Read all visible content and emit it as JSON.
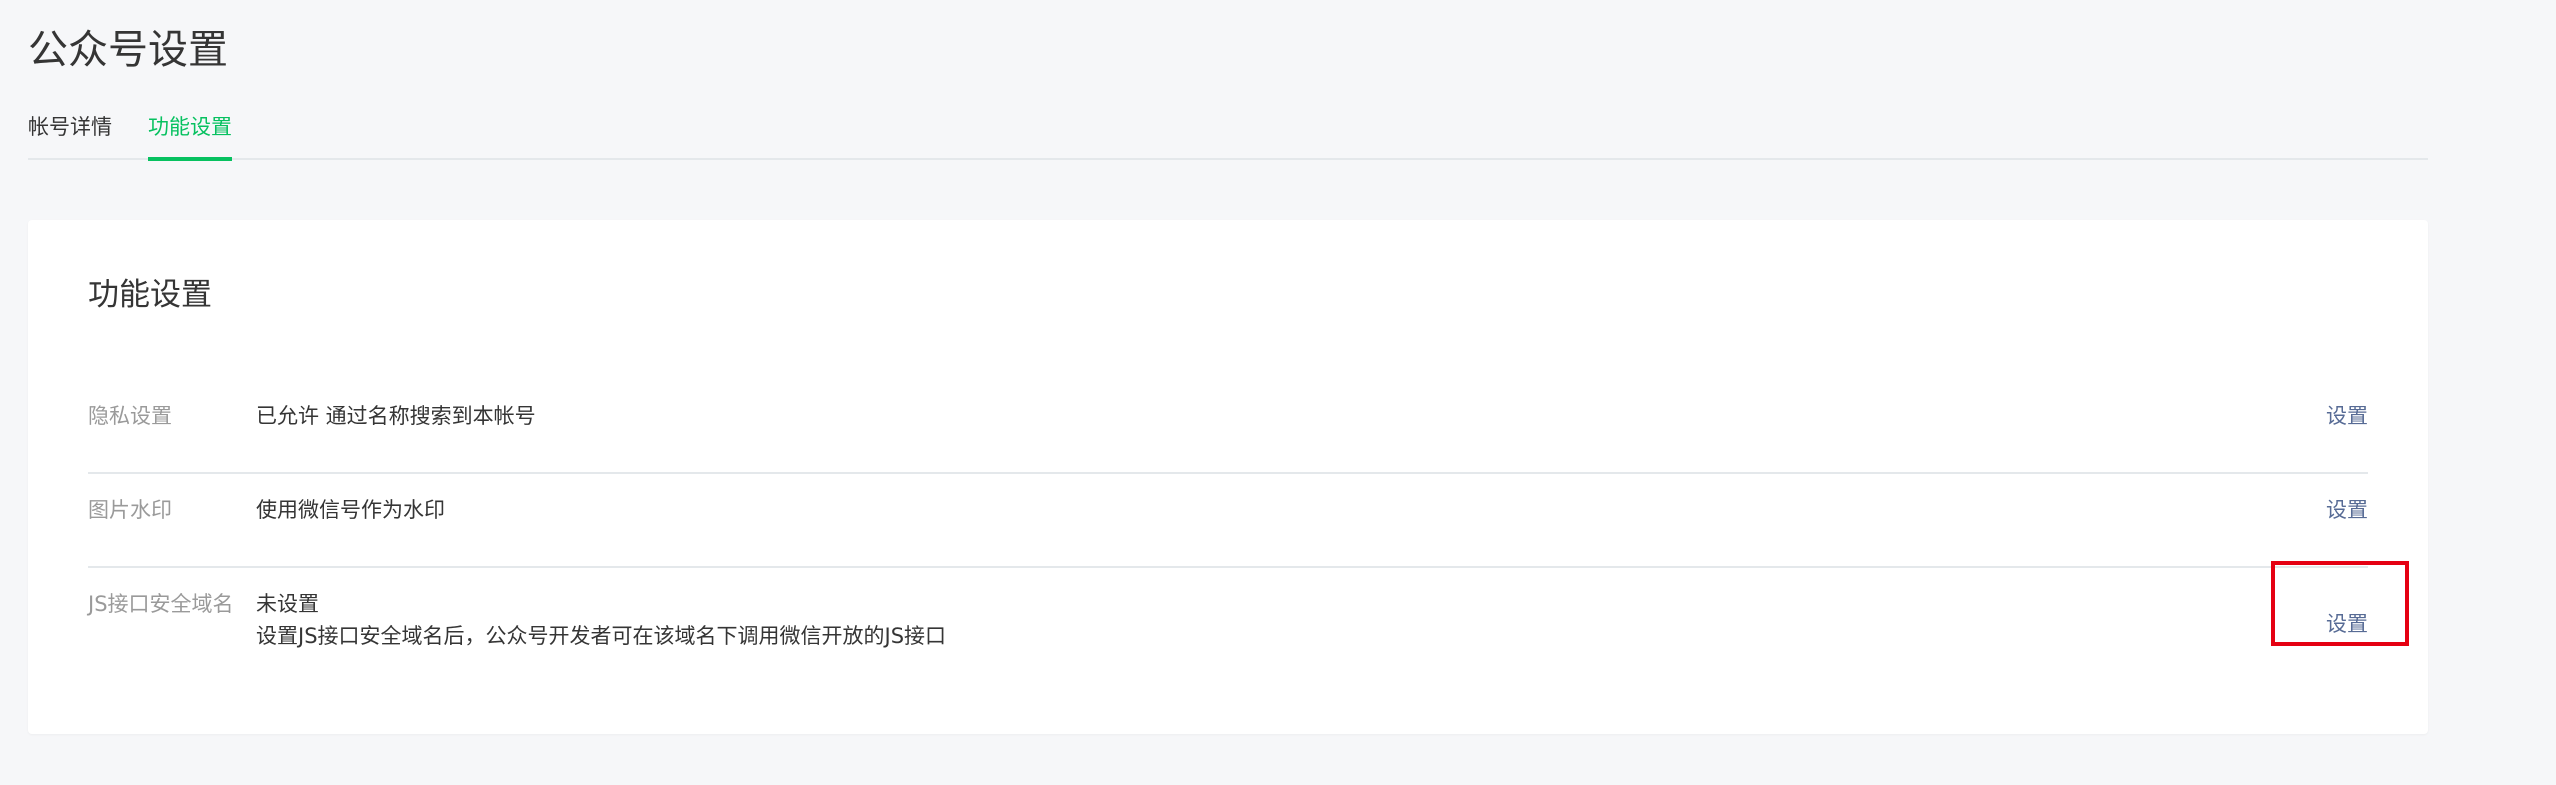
{
  "page": {
    "title": "公众号设置"
  },
  "tabs": [
    {
      "label": "帐号详情",
      "active": false
    },
    {
      "label": "功能设置",
      "active": true
    }
  ],
  "colors": {
    "accent": "#07c160",
    "link": "#576b95",
    "highlight": "#e50012",
    "background": "#f6f7f9"
  },
  "card": {
    "title": "功能设置",
    "rows": [
      {
        "label": "隐私设置",
        "value": "已允许 通过名称搜索到本帐号",
        "action": "设置"
      },
      {
        "label": "图片水印",
        "value": "使用微信号作为水印",
        "action": "设置"
      },
      {
        "label": "JS接口安全域名",
        "value": "未设置",
        "description": "设置JS接口安全域名后，公众号开发者可在该域名下调用微信开放的JS接口",
        "action": "设置"
      }
    ]
  }
}
